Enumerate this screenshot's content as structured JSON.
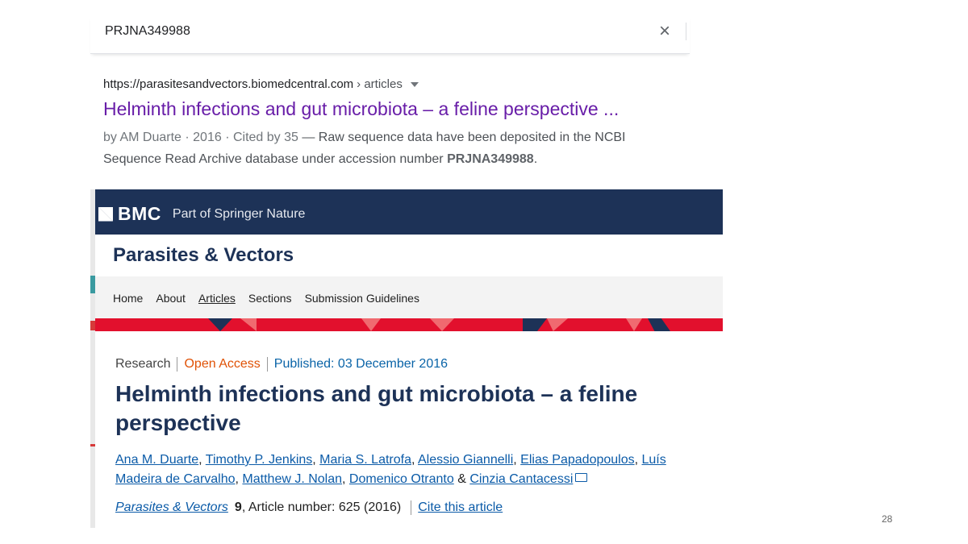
{
  "search": {
    "query": "PRJNA349988",
    "close_label": "×"
  },
  "result": {
    "domain": "https://parasitesandvectors.biomedcentral.com",
    "path": "› articles",
    "title": "Helminth infections and gut microbiota – a feline perspective ...",
    "meta": "by AM Duarte · 2016 · Cited by 35",
    "snippet_pre": " — Raw sequence data have been deposited in the NCBI Sequence Read Archive database under accession number ",
    "snippet_bold": "PRJNA349988",
    "snippet_post": "."
  },
  "bmc": {
    "logo": "BMC",
    "tagline": "Part of Springer Nature",
    "journal": "Parasites & Vectors",
    "nav": [
      "Home",
      "About",
      "Articles",
      "Sections",
      "Submission Guidelines"
    ],
    "colors": {
      "navy": "#1d3257",
      "red": "#e2102d",
      "link": "#0b5ba8",
      "open_access": "#e05206"
    }
  },
  "article": {
    "type": "Research",
    "access": "Open Access",
    "published": "Published: 03 December 2016",
    "title": "Helminth infections and gut microbiota – a feline perspective",
    "authors": [
      "Ana M. Duarte",
      "Timothy P. Jenkins",
      "Maria S. Latrofa",
      "Alessio Giannelli",
      "Elias Papadopoulos",
      "Luís Madeira de Carvalho",
      "Matthew J. Nolan",
      "Domenico Otranto",
      "Cinzia Cantacessi"
    ],
    "journal": "Parasites & Vectors",
    "volume": "9",
    "article_number": ", Article number: 625 (2016)",
    "cite_link": "Cite this article"
  },
  "slide": {
    "page_number": "28"
  }
}
